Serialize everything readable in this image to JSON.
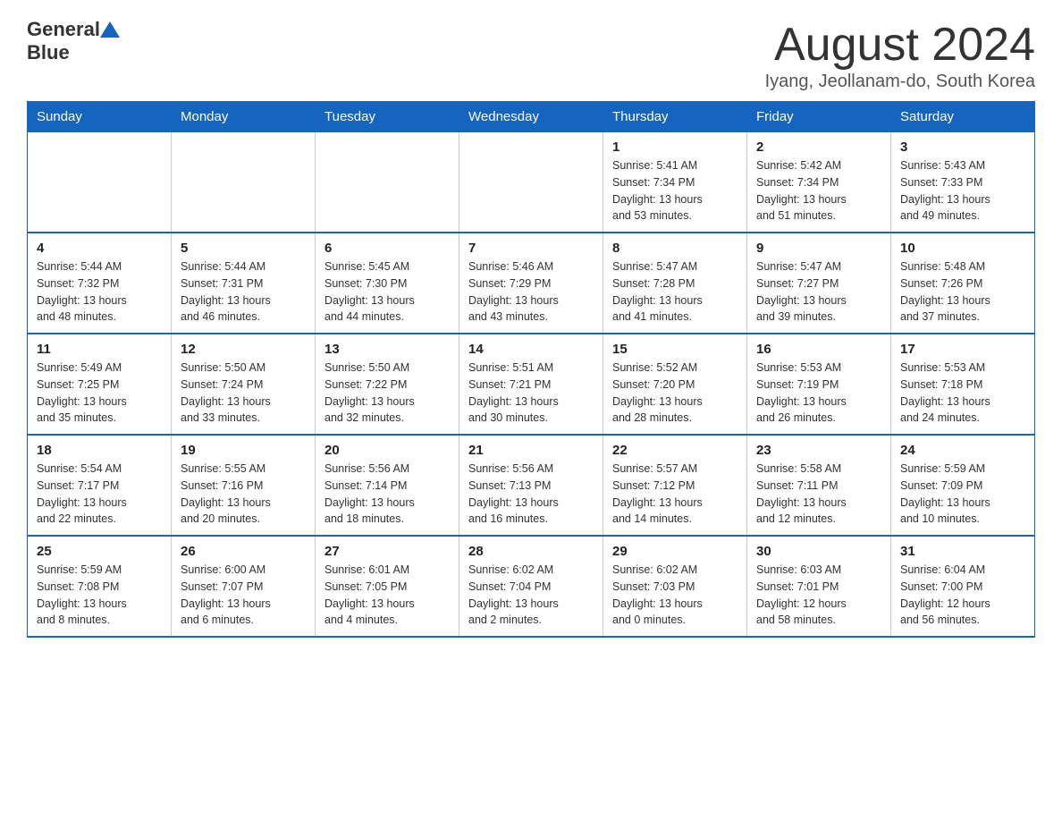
{
  "header": {
    "logo_general": "General",
    "logo_blue": "Blue",
    "month_title": "August 2024",
    "location": "Iyang, Jeollanam-do, South Korea"
  },
  "days_of_week": [
    "Sunday",
    "Monday",
    "Tuesday",
    "Wednesday",
    "Thursday",
    "Friday",
    "Saturday"
  ],
  "weeks": [
    [
      {
        "day": "",
        "info": ""
      },
      {
        "day": "",
        "info": ""
      },
      {
        "day": "",
        "info": ""
      },
      {
        "day": "",
        "info": ""
      },
      {
        "day": "1",
        "info": "Sunrise: 5:41 AM\nSunset: 7:34 PM\nDaylight: 13 hours\nand 53 minutes."
      },
      {
        "day": "2",
        "info": "Sunrise: 5:42 AM\nSunset: 7:34 PM\nDaylight: 13 hours\nand 51 minutes."
      },
      {
        "day": "3",
        "info": "Sunrise: 5:43 AM\nSunset: 7:33 PM\nDaylight: 13 hours\nand 49 minutes."
      }
    ],
    [
      {
        "day": "4",
        "info": "Sunrise: 5:44 AM\nSunset: 7:32 PM\nDaylight: 13 hours\nand 48 minutes."
      },
      {
        "day": "5",
        "info": "Sunrise: 5:44 AM\nSunset: 7:31 PM\nDaylight: 13 hours\nand 46 minutes."
      },
      {
        "day": "6",
        "info": "Sunrise: 5:45 AM\nSunset: 7:30 PM\nDaylight: 13 hours\nand 44 minutes."
      },
      {
        "day": "7",
        "info": "Sunrise: 5:46 AM\nSunset: 7:29 PM\nDaylight: 13 hours\nand 43 minutes."
      },
      {
        "day": "8",
        "info": "Sunrise: 5:47 AM\nSunset: 7:28 PM\nDaylight: 13 hours\nand 41 minutes."
      },
      {
        "day": "9",
        "info": "Sunrise: 5:47 AM\nSunset: 7:27 PM\nDaylight: 13 hours\nand 39 minutes."
      },
      {
        "day": "10",
        "info": "Sunrise: 5:48 AM\nSunset: 7:26 PM\nDaylight: 13 hours\nand 37 minutes."
      }
    ],
    [
      {
        "day": "11",
        "info": "Sunrise: 5:49 AM\nSunset: 7:25 PM\nDaylight: 13 hours\nand 35 minutes."
      },
      {
        "day": "12",
        "info": "Sunrise: 5:50 AM\nSunset: 7:24 PM\nDaylight: 13 hours\nand 33 minutes."
      },
      {
        "day": "13",
        "info": "Sunrise: 5:50 AM\nSunset: 7:22 PM\nDaylight: 13 hours\nand 32 minutes."
      },
      {
        "day": "14",
        "info": "Sunrise: 5:51 AM\nSunset: 7:21 PM\nDaylight: 13 hours\nand 30 minutes."
      },
      {
        "day": "15",
        "info": "Sunrise: 5:52 AM\nSunset: 7:20 PM\nDaylight: 13 hours\nand 28 minutes."
      },
      {
        "day": "16",
        "info": "Sunrise: 5:53 AM\nSunset: 7:19 PM\nDaylight: 13 hours\nand 26 minutes."
      },
      {
        "day": "17",
        "info": "Sunrise: 5:53 AM\nSunset: 7:18 PM\nDaylight: 13 hours\nand 24 minutes."
      }
    ],
    [
      {
        "day": "18",
        "info": "Sunrise: 5:54 AM\nSunset: 7:17 PM\nDaylight: 13 hours\nand 22 minutes."
      },
      {
        "day": "19",
        "info": "Sunrise: 5:55 AM\nSunset: 7:16 PM\nDaylight: 13 hours\nand 20 minutes."
      },
      {
        "day": "20",
        "info": "Sunrise: 5:56 AM\nSunset: 7:14 PM\nDaylight: 13 hours\nand 18 minutes."
      },
      {
        "day": "21",
        "info": "Sunrise: 5:56 AM\nSunset: 7:13 PM\nDaylight: 13 hours\nand 16 minutes."
      },
      {
        "day": "22",
        "info": "Sunrise: 5:57 AM\nSunset: 7:12 PM\nDaylight: 13 hours\nand 14 minutes."
      },
      {
        "day": "23",
        "info": "Sunrise: 5:58 AM\nSunset: 7:11 PM\nDaylight: 13 hours\nand 12 minutes."
      },
      {
        "day": "24",
        "info": "Sunrise: 5:59 AM\nSunset: 7:09 PM\nDaylight: 13 hours\nand 10 minutes."
      }
    ],
    [
      {
        "day": "25",
        "info": "Sunrise: 5:59 AM\nSunset: 7:08 PM\nDaylight: 13 hours\nand 8 minutes."
      },
      {
        "day": "26",
        "info": "Sunrise: 6:00 AM\nSunset: 7:07 PM\nDaylight: 13 hours\nand 6 minutes."
      },
      {
        "day": "27",
        "info": "Sunrise: 6:01 AM\nSunset: 7:05 PM\nDaylight: 13 hours\nand 4 minutes."
      },
      {
        "day": "28",
        "info": "Sunrise: 6:02 AM\nSunset: 7:04 PM\nDaylight: 13 hours\nand 2 minutes."
      },
      {
        "day": "29",
        "info": "Sunrise: 6:02 AM\nSunset: 7:03 PM\nDaylight: 13 hours\nand 0 minutes."
      },
      {
        "day": "30",
        "info": "Sunrise: 6:03 AM\nSunset: 7:01 PM\nDaylight: 12 hours\nand 58 minutes."
      },
      {
        "day": "31",
        "info": "Sunrise: 6:04 AM\nSunset: 7:00 PM\nDaylight: 12 hours\nand 56 minutes."
      }
    ]
  ]
}
